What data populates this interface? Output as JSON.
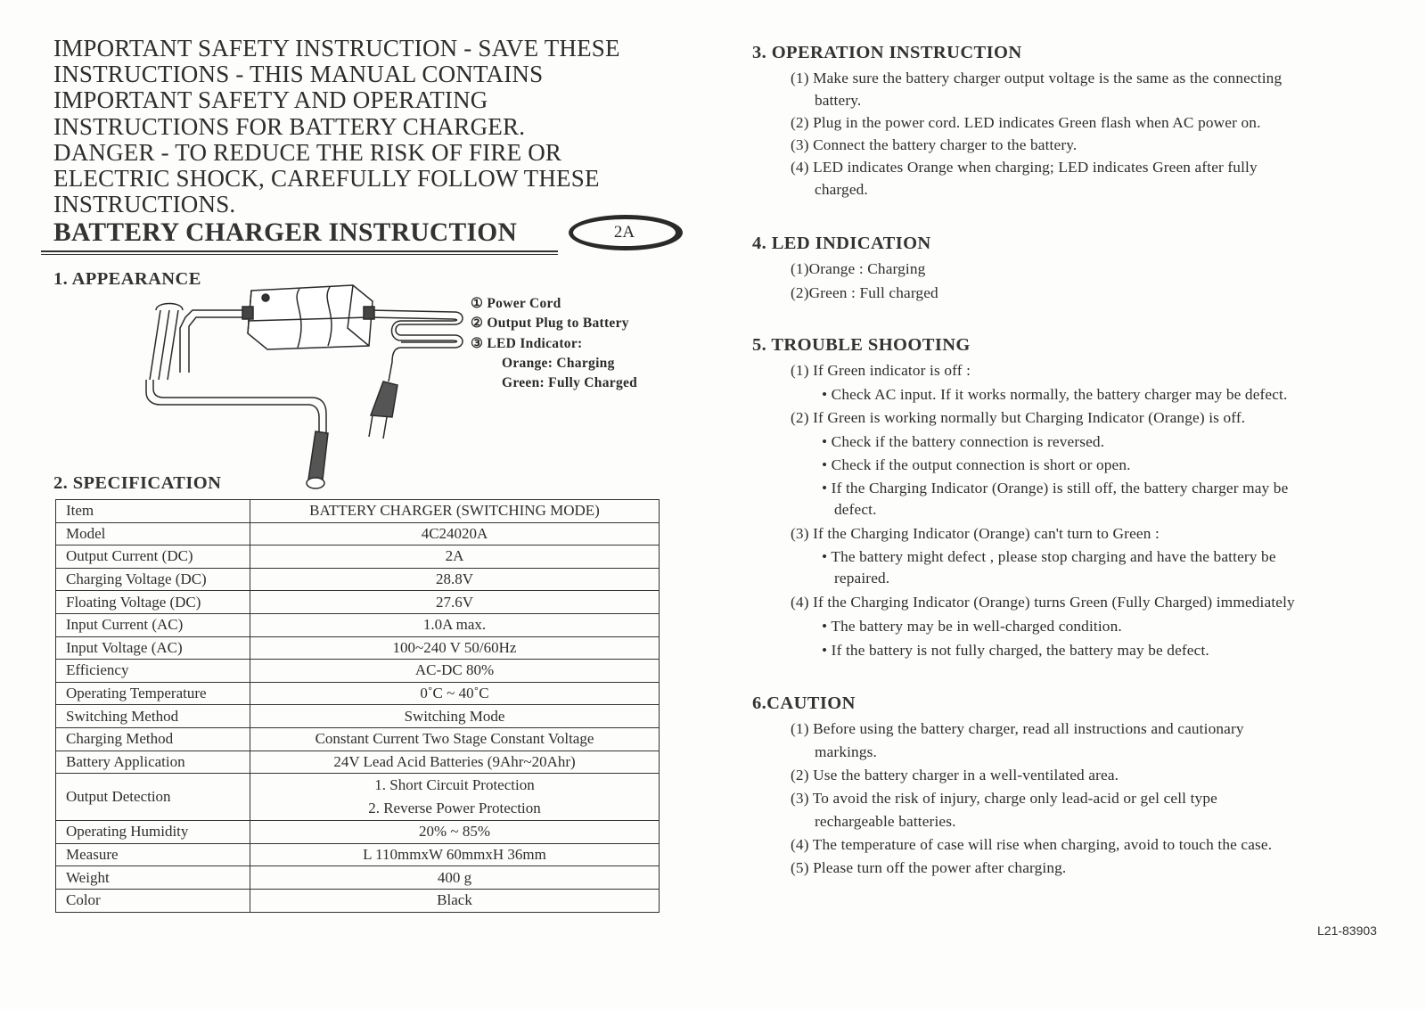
{
  "warning": {
    "lines": [
      "IMPORTANT SAFETY INSTRUCTION  -  SAVE THESE",
      "INSTRUCTIONS  -  THIS MANUAL CONTAINS",
      "IMPORTANT SAFETY AND OPERATING",
      "INSTRUCTIONS FOR BATTERY CHARGER.",
      "DANGER  -  TO REDUCE THE RISK OF FIRE OR",
      "ELECTRIC SHOCK, CAREFULLY FOLLOW THESE",
      "INSTRUCTIONS."
    ]
  },
  "header": {
    "title": "BATTERY CHARGER INSTRUCTION",
    "badge": "2A"
  },
  "appearance": {
    "heading": "1. APPEARANCE",
    "diagram_icon": "battery-charger-diagram",
    "legend": [
      {
        "num": "①",
        "label": "Power Cord"
      },
      {
        "num": "②",
        "label": "Output Plug to Battery"
      },
      {
        "num": "③",
        "label": "LED Indicator:"
      }
    ],
    "led_states": [
      "Orange: Charging",
      "Green: Fully Charged"
    ]
  },
  "specification": {
    "heading": "2. SPECIFICATION",
    "rows": [
      {
        "item": "Item",
        "value": "BATTERY CHARGER (SWITCHING MODE)"
      },
      {
        "item": "Model",
        "value": "4C24020A"
      },
      {
        "item": "Output Current (DC)",
        "value": "2A"
      },
      {
        "item": "Charging Voltage (DC)",
        "value": "28.8V"
      },
      {
        "item": "Floating Voltage (DC)",
        "value": "27.6V"
      },
      {
        "item": "Input Current (AC)",
        "value": "1.0A  max."
      },
      {
        "item": "Input Voltage (AC)",
        "value": "100~240 V  50/60Hz"
      },
      {
        "item": "Efficiency",
        "value": "AC-DC  80%"
      },
      {
        "item": "Operating Temperature",
        "value": "0˚C ~ 40˚C"
      },
      {
        "item": "Switching Method",
        "value": "Switching Mode"
      },
      {
        "item": "Charging Method",
        "value": "Constant Current Two Stage Constant Voltage"
      },
      {
        "item": "Battery Application",
        "value": "24V Lead Acid Batteries (9Ahr~20Ahr)"
      },
      {
        "item": "Output Detection",
        "values": [
          "1. Short Circuit Protection",
          "2. Reverse Power Protection"
        ]
      },
      {
        "item": "Operating Humidity",
        "value": "20% ~ 85%"
      },
      {
        "item": "Measure",
        "value": "L 110mmxW 60mmxH 36mm"
      },
      {
        "item": "Weight",
        "value": "400 g"
      },
      {
        "item": "Color",
        "value": "Black"
      }
    ]
  },
  "operation": {
    "heading": "3. OPERATION INSTRUCTION",
    "items": [
      {
        "num": "(1)",
        "lines": [
          "Make sure the battery charger output voltage is the same as the connecting",
          "battery."
        ]
      },
      {
        "num": "(2)",
        "lines": [
          "Plug in the power cord. LED indicates Green flash when AC power on."
        ]
      },
      {
        "num": "(3)",
        "lines": [
          "Connect the battery charger to the battery."
        ]
      },
      {
        "num": "(4)",
        "lines": [
          "LED indicates Orange when charging; LED indicates Green after fully",
          "charged."
        ]
      }
    ]
  },
  "led": {
    "heading": "4. LED INDICATION",
    "items": [
      "(1)Orange : Charging",
      "(2)Green : Full charged"
    ]
  },
  "troubleshooting": {
    "heading": "5. TROUBLE SHOOTING",
    "items": [
      {
        "num": "(1)",
        "text": "If Green indicator is off :",
        "bullets": [
          [
            "Check AC input. If it works normally, the battery charger may be defect."
          ]
        ]
      },
      {
        "num": "(2)",
        "text": "If Green is working normally but Charging Indicator (Orange) is off.",
        "bullets": [
          [
            "Check if the battery connection is reversed."
          ],
          [
            "Check if the output connection is short or open."
          ],
          [
            "If the Charging Indicator (Orange) is still off, the battery charger may be",
            "defect."
          ]
        ]
      },
      {
        "num": "(3)",
        "text": "If the Charging Indicator (Orange) can't turn to Green :",
        "bullets": [
          [
            "The battery might defect , please stop charging and have the battery be",
            "repaired."
          ]
        ]
      },
      {
        "num": "(4)",
        "text": "If the Charging Indicator (Orange) turns Green (Fully Charged) immediately",
        "bullets": [
          [
            "The battery may be in well-charged condition."
          ],
          [
            "If the battery is not fully charged, the battery may be defect."
          ]
        ]
      }
    ]
  },
  "caution": {
    "heading": "6.CAUTION",
    "items": [
      {
        "num": "(1)",
        "lines": [
          "Before using the battery charger, read all instructions and cautionary",
          "markings."
        ]
      },
      {
        "num": "(2)",
        "lines": [
          "Use the battery charger in a well-ventilated area."
        ]
      },
      {
        "num": "(3)",
        "lines": [
          "To avoid the risk of injury, charge only lead-acid or gel cell type",
          "rechargeable batteries."
        ]
      },
      {
        "num": "(4)",
        "lines": [
          "The temperature of case will rise when charging, avoid to touch the case."
        ]
      },
      {
        "num": "(5)",
        "lines": [
          "Please turn off the power after charging."
        ]
      }
    ]
  },
  "footer": {
    "doc_number": "L21-83903"
  }
}
